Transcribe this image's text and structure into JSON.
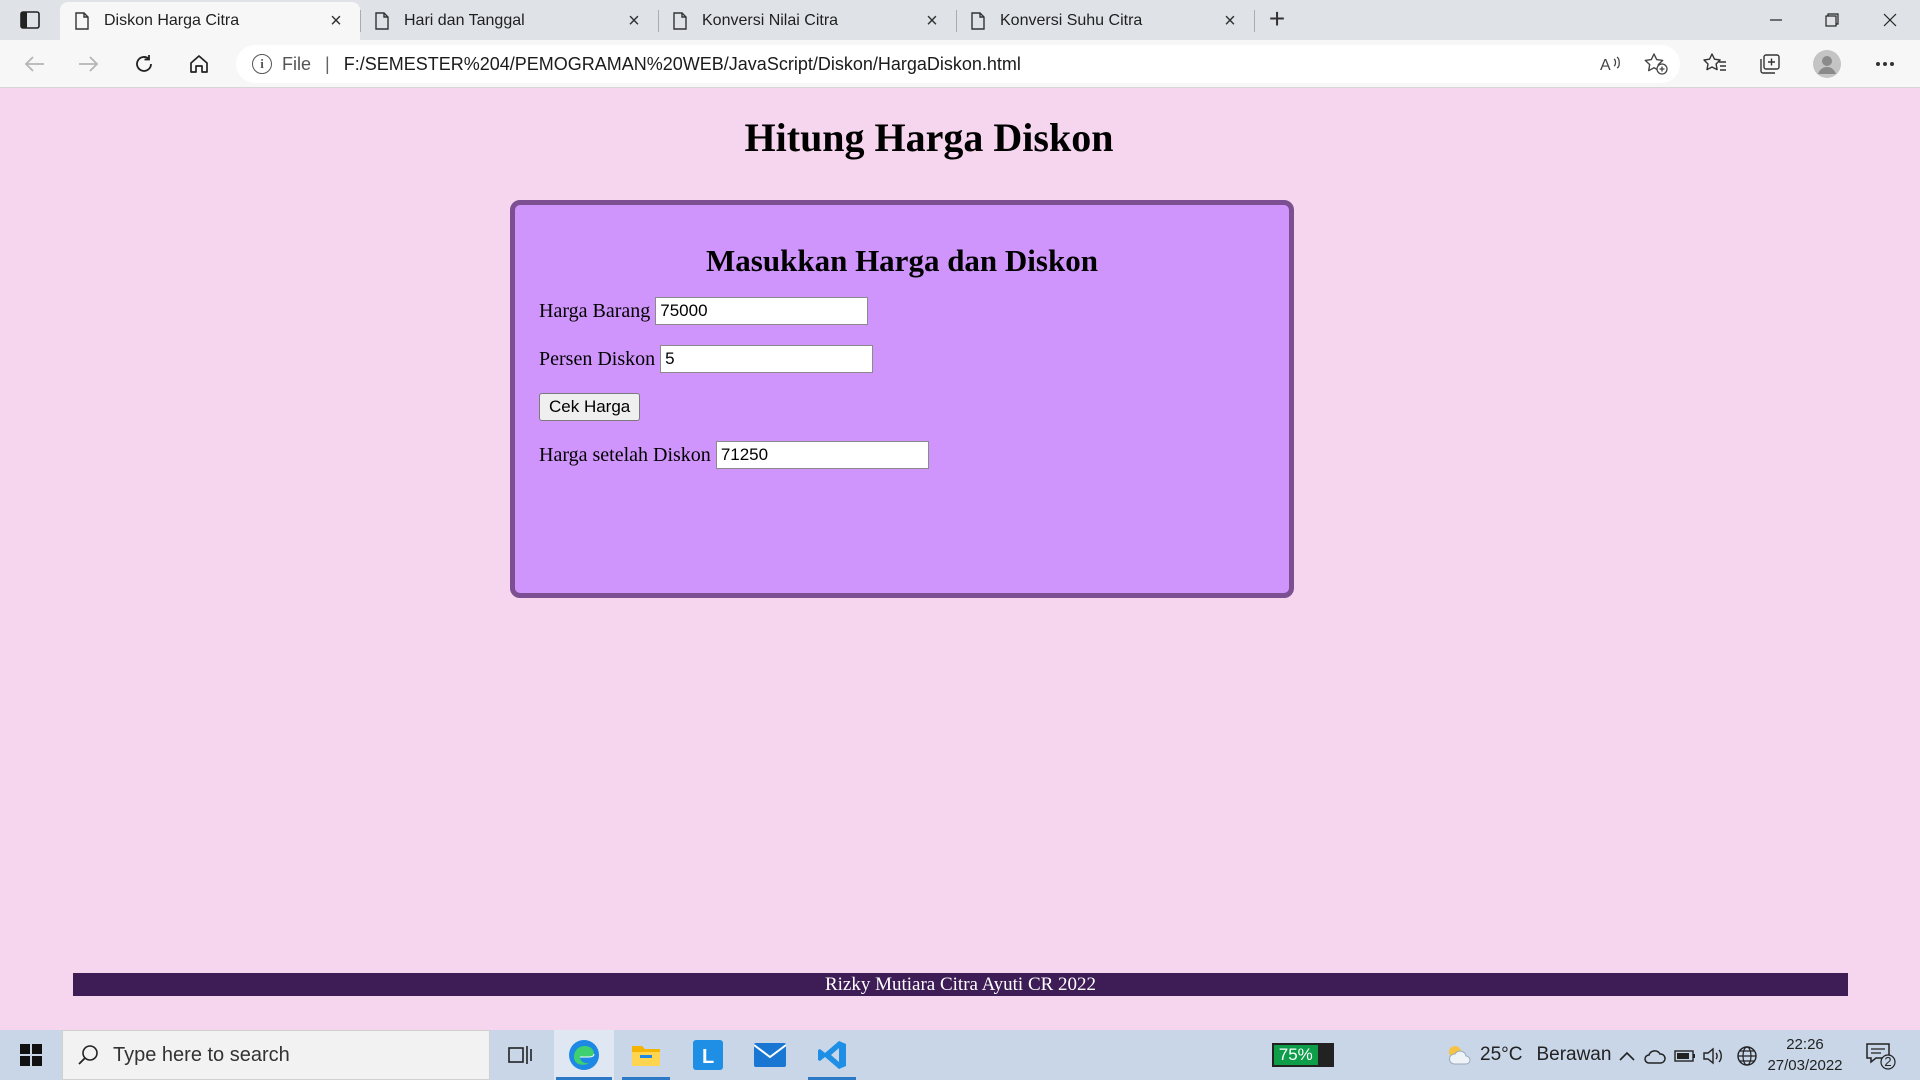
{
  "browser": {
    "tabs": [
      {
        "title": "Diskon Harga Citra",
        "active": true
      },
      {
        "title": "Hari dan Tanggal",
        "active": false
      },
      {
        "title": "Konversi Nilai Citra",
        "active": false
      },
      {
        "title": "Konversi Suhu Citra",
        "active": false
      }
    ],
    "address": {
      "label": "File",
      "url": "F:/SEMESTER%204/PEMOGRAMAN%20WEB/JavaScript/Diskon/HargaDiskon.html"
    }
  },
  "page": {
    "heading": "Hitung Harga Diskon",
    "form": {
      "heading": "Masukkan Harga dan Diskon",
      "harga_label": "Harga Barang",
      "harga_value": "75000",
      "diskon_label": "Persen Diskon",
      "diskon_value": "5",
      "button_label": "Cek Harga",
      "result_label": "Harga setelah Diskon",
      "result_value": "71250"
    },
    "footer": "Rizky Mutiara Citra Ayuti CR 2022",
    "colors": {
      "background": "#f6d6ee",
      "card": "#d095fc",
      "card_border": "#7b4f91",
      "footer": "#3e1d57"
    }
  },
  "taskbar": {
    "search_placeholder": "Type here to search",
    "battery": "75%",
    "battery_level": 0.75,
    "weather_temp": "25°C",
    "weather_desc": "Berawan",
    "time": "22:26",
    "date": "27/03/2022",
    "notification_count": "2",
    "apps": [
      "task-view-icon",
      "edge-icon",
      "file-explorer-icon",
      "l-app-icon",
      "mail-icon",
      "vscode-icon"
    ]
  }
}
